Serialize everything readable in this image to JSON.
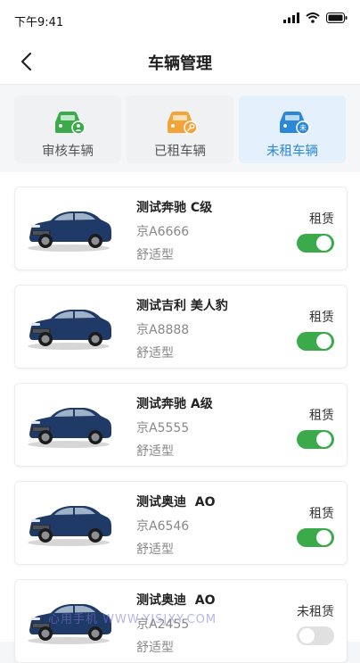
{
  "status_bar": {
    "time": "下午9:41"
  },
  "nav": {
    "title": "车辆管理"
  },
  "tabs": [
    {
      "label": "审核车辆",
      "icon": "car-audit-icon",
      "color": "#3aaa4a",
      "active": false
    },
    {
      "label": "已租车辆",
      "icon": "car-key-icon",
      "color": "#f2a33a",
      "active": false
    },
    {
      "label": "未租车辆",
      "icon": "car-unrented-icon",
      "color": "#2b88d8",
      "active": true
    }
  ],
  "vehicles": [
    {
      "name": "测试奔驰 C级",
      "plate": "京A6666",
      "type": "舒适型",
      "status": "租赁",
      "toggle_on": true
    },
    {
      "name": "测试吉利 美人豹",
      "plate": "京A8888",
      "type": "舒适型",
      "status": "租赁",
      "toggle_on": true
    },
    {
      "name": "测试奔驰 A级",
      "plate": "京A5555",
      "type": "舒适型",
      "status": "租赁",
      "toggle_on": true
    },
    {
      "name": "测试奥迪  AO",
      "plate": "京A6546",
      "type": "舒适型",
      "status": "租赁",
      "toggle_on": true
    },
    {
      "name": "测试奥迪  AO",
      "plate": "京A2455",
      "type": "舒适型",
      "status": "未租赁",
      "toggle_on": false
    }
  ],
  "watermark": "心用手机 WWW.YJSJXY.COM",
  "colors": {
    "accent_green": "#3aaa4a",
    "accent_blue": "#2b88d8",
    "accent_orange": "#f2a33a"
  }
}
